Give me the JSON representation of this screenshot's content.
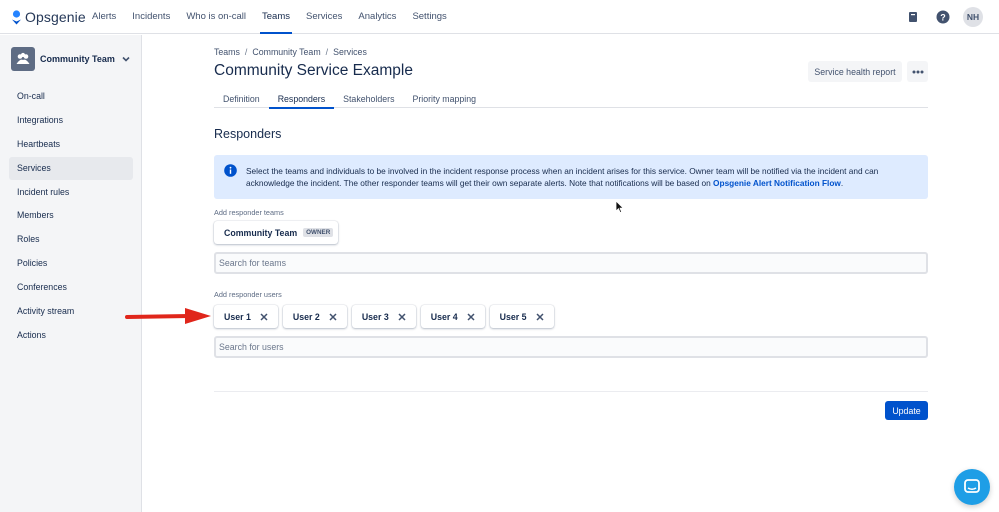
{
  "app": {
    "name": "Opsgenie"
  },
  "topnav": {
    "links": [
      "Alerts",
      "Incidents",
      "Who is on-call",
      "Teams",
      "Services",
      "Analytics",
      "Settings"
    ],
    "active": "Teams",
    "avatar_initials": "NH",
    "icons": [
      "book-icon",
      "help-icon"
    ]
  },
  "sidebar": {
    "team_name": "Community Team",
    "items": [
      "On-call",
      "Integrations",
      "Heartbeats",
      "Services",
      "Incident rules",
      "Members",
      "Roles",
      "Policies",
      "Conferences",
      "Activity stream",
      "Actions"
    ],
    "active": "Services"
  },
  "breadcrumb": [
    "Teams",
    "Community Team",
    "Services"
  ],
  "page": {
    "title": "Community Service Example",
    "health_button": "Service health report"
  },
  "tabs": [
    "Definition",
    "Responders",
    "Stakeholders",
    "Priority mapping"
  ],
  "active_tab": "Responders",
  "responders": {
    "heading": "Responders",
    "info_text": "Select the teams and individuals to be involved in the incident response process when an incident arises for this service. Owner team will be notified via the incident and can acknowledge the incident. The other responder teams will get their own separate alerts. Note that notifications will be based on ",
    "info_link": "Opsgenie Alert Notification Flow",
    "info_tail": ".",
    "teams_label": "Add responder teams",
    "team_card": {
      "name": "Community Team",
      "badge": "OWNER"
    },
    "teams_placeholder": "Search for teams",
    "users_label": "Add responder users",
    "users": [
      "User 1",
      "User 2",
      "User 3",
      "User 4",
      "User 5"
    ],
    "users_placeholder": "Search for users",
    "update_button": "Update"
  },
  "colors": {
    "brand": "#0052cc",
    "info_bg": "#deebff",
    "annotation_arrow": "#e0261b",
    "chat": "#1e9ee6"
  }
}
